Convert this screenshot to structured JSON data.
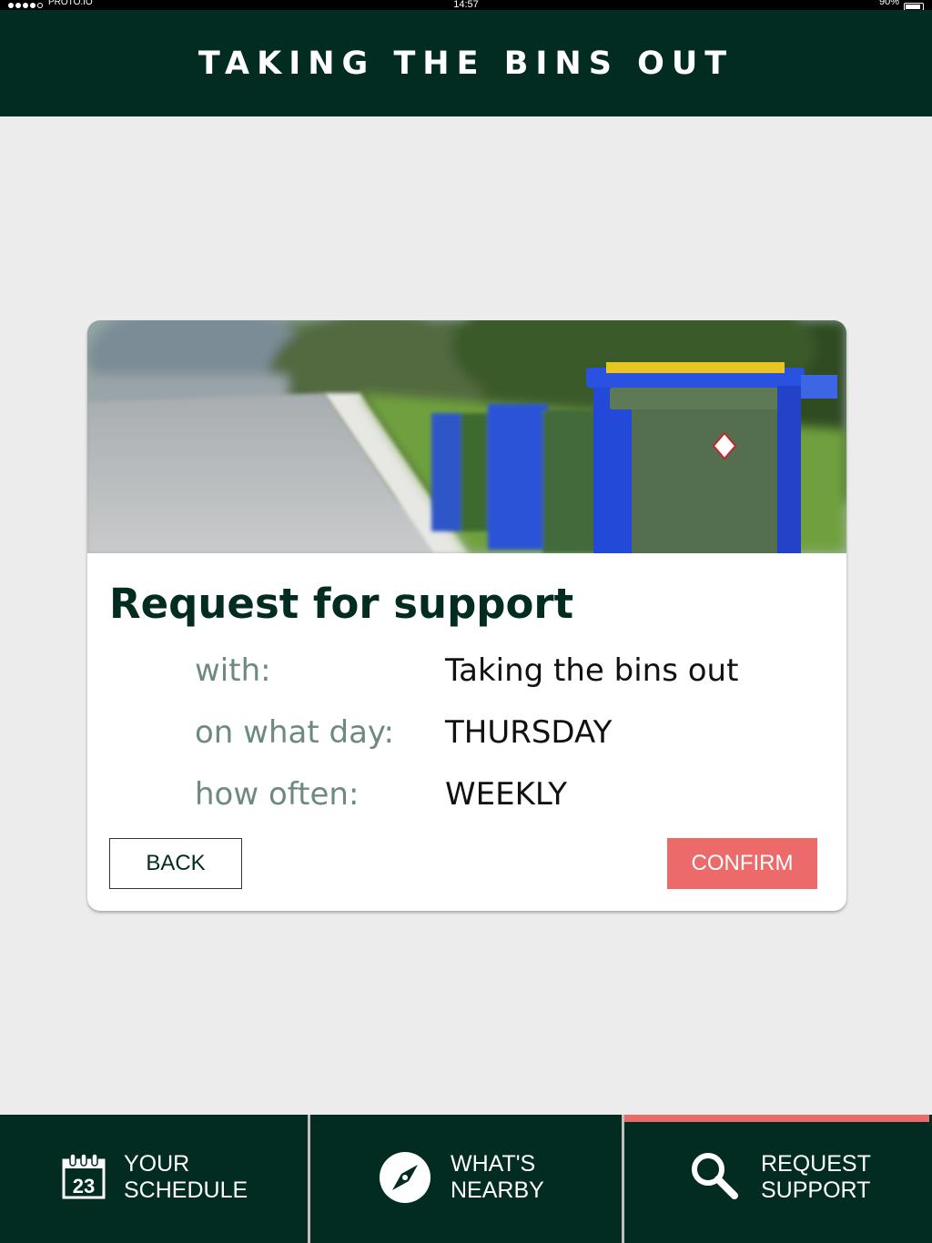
{
  "status_bar": {
    "carrier": "PROTO.IO",
    "time": "14:57",
    "battery": "90%"
  },
  "header": {
    "title": "TAKING THE BINS OUT"
  },
  "card": {
    "image_icon": "wheelie-bins-photo",
    "title": "Request for support",
    "details": {
      "with_label": "with:",
      "with_value": "Taking the bins out",
      "day_label": "on what day:",
      "day_value": "THURSDAY",
      "often_label": "how often:",
      "often_value": "WEEKLY"
    },
    "back_label": "BACK",
    "confirm_label": "CONFIRM"
  },
  "bottom_nav": {
    "tabs": [
      {
        "icon": "calendar-icon",
        "calendar_day": "23",
        "label": "YOUR\nSCHEDULE"
      },
      {
        "icon": "compass-icon",
        "label": "WHAT'S\nNEARBY"
      },
      {
        "icon": "search-icon",
        "label": "REQUEST\nSUPPORT",
        "active": true
      }
    ]
  },
  "colors": {
    "primary": "#022b22",
    "accent": "#ec6b6a",
    "background": "#ececec",
    "label_gray": "#6e8a7e"
  }
}
